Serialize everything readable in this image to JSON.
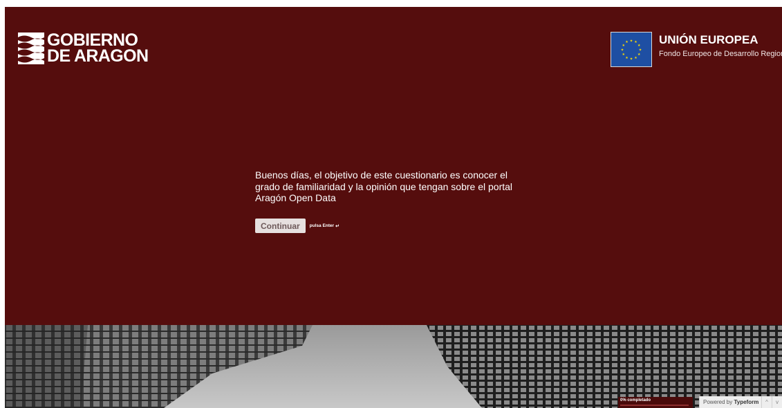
{
  "header": {
    "logo_line1": "GOBIERNO",
    "logo_line2": "DE ARAGON",
    "eu_title": "UNIÓN EUROPEA",
    "eu_subtitle": "Fondo Europeo de Desarrollo Regional"
  },
  "question": {
    "text": "Buenos días, el objetivo de este cuestionario es conocer el grado de familiaridad y la opinión que tengan sobre el portal Aragón Open Data",
    "button_label": "Continuar",
    "hint_label": "pulsa Enter",
    "hint_icon": "↵"
  },
  "footer": {
    "progress_label": "0% completado",
    "progress_fraction": 0,
    "powered_prefix": "Powered by ",
    "powered_brand": "Typeform",
    "nav_up_glyph": "^",
    "nav_down_glyph": "v"
  },
  "colors": {
    "hero_background": "#550d0d",
    "eu_flag": "#1e4fa3",
    "eu_stars": "#ffdd00",
    "button_background": "#e6e0df"
  }
}
